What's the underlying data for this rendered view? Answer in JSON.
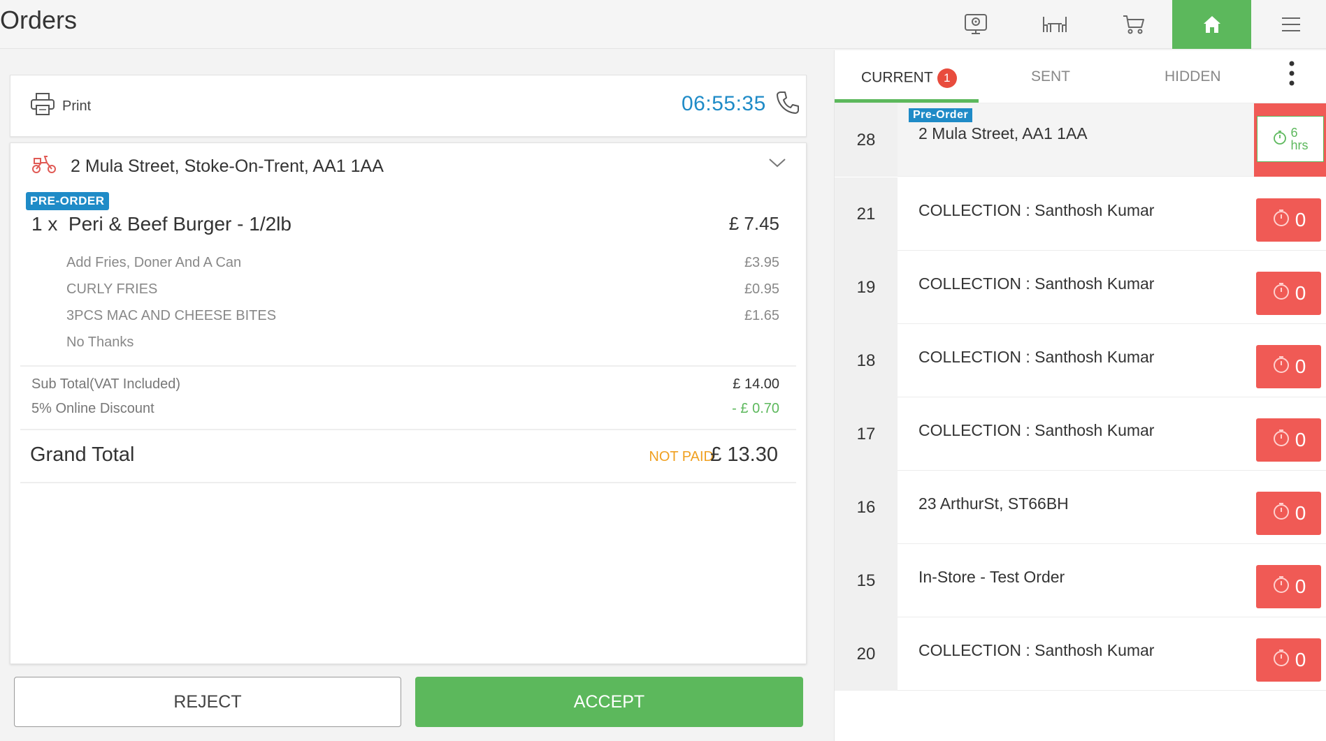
{
  "header": {
    "title": "Orders",
    "icons": [
      "monitor-icon",
      "table-icon",
      "cart-icon",
      "home-icon",
      "menu-icon"
    ]
  },
  "order": {
    "print_label": "Print",
    "timer": "06:55:35",
    "address": "2 Mula Street, Stoke-On-Trent, AA1 1AA",
    "badge": "PRE-ORDER",
    "item": {
      "qty": "1 x",
      "name": "Peri & Beef Burger - 1/2lb",
      "price": "£ 7.45",
      "extras": [
        {
          "name": "Add Fries, Doner And A Can",
          "price": "£3.95"
        },
        {
          "name": "CURLY FRIES",
          "price": "£0.95"
        },
        {
          "name": "3PCS MAC AND CHEESE BITES",
          "price": "£1.65"
        },
        {
          "name": "No Thanks",
          "price": ""
        }
      ]
    },
    "subtotal_label": "Sub Total(VAT Included)",
    "subtotal": "£ 14.00",
    "discount_label": "5% Online Discount",
    "discount": "- £ 0.70",
    "grand_label": "Grand Total",
    "payment_status": "NOT PAID",
    "grand_total": "£ 13.30",
    "reject_label": "REJECT",
    "accept_label": "ACCEPT"
  },
  "tabs": {
    "current": "CURRENT",
    "current_count": "1",
    "sent": "SENT",
    "hidden": "HIDDEN"
  },
  "orders_list": [
    {
      "id": "28",
      "tag": "Pre-Order",
      "desc": "2 Mula Street, AA1 1AA",
      "timer_value": "6",
      "timer_unit": "hrs"
    },
    {
      "id": "21",
      "desc": "COLLECTION : Santhosh Kumar",
      "timer_value": "0"
    },
    {
      "id": "19",
      "desc": "COLLECTION : Santhosh Kumar",
      "timer_value": "0"
    },
    {
      "id": "18",
      "desc": "COLLECTION : Santhosh Kumar",
      "timer_value": "0"
    },
    {
      "id": "17",
      "desc": "COLLECTION : Santhosh Kumar",
      "timer_value": "0"
    },
    {
      "id": "16",
      "desc": "23 ArthurSt, ST66BH",
      "timer_value": "0"
    },
    {
      "id": "15",
      "desc": "In-Store - Test Order",
      "timer_value": "0"
    },
    {
      "id": "20",
      "desc": "COLLECTION : Santhosh Kumar",
      "timer_value": "0"
    }
  ],
  "colors": {
    "accent_green": "#5cb85c",
    "accent_blue": "#1f8bc7",
    "alert_red": "#f05a55",
    "warning_orange": "#f0a020"
  }
}
